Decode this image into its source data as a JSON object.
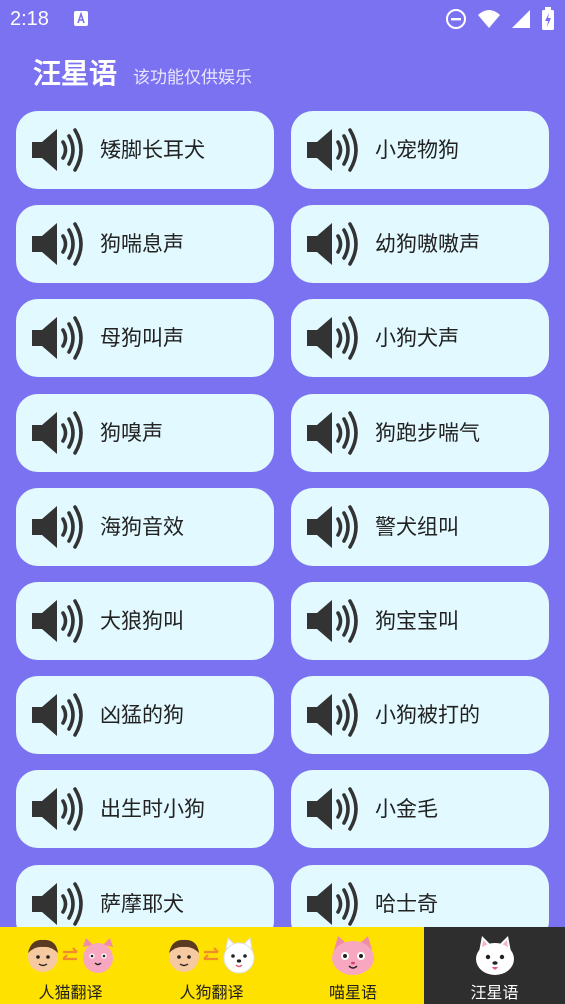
{
  "status_bar": {
    "time": "2:18"
  },
  "header": {
    "title": "汪星语",
    "subtitle": "该功能仅供娱乐"
  },
  "sounds": [
    "矮脚长耳犬",
    "小宠物狗",
    "狗喘息声",
    "幼狗嗷嗷声",
    "母狗叫声",
    "小狗犬声",
    "狗嗅声",
    "狗跑步喘气",
    "海狗音效",
    "警犬组叫",
    "大狼狗叫",
    "狗宝宝叫",
    "凶猛的狗",
    "小狗被打的",
    "出生时小狗",
    "小金毛",
    "萨摩耶犬",
    "哈士奇"
  ],
  "bottom_nav": {
    "items": [
      {
        "label": "人猫翻译",
        "icon": "human-to-cat-icon"
      },
      {
        "label": "人狗翻译",
        "icon": "human-to-dog-icon"
      },
      {
        "label": "喵星语",
        "icon": "cat-face-icon"
      },
      {
        "label": "汪星语",
        "icon": "dog-face-icon",
        "active": true
      }
    ]
  },
  "colors": {
    "background": "#7B72F2",
    "card": "#E1F9FF",
    "nav": "#FFE100",
    "nav_active": "#2E2E2E"
  }
}
